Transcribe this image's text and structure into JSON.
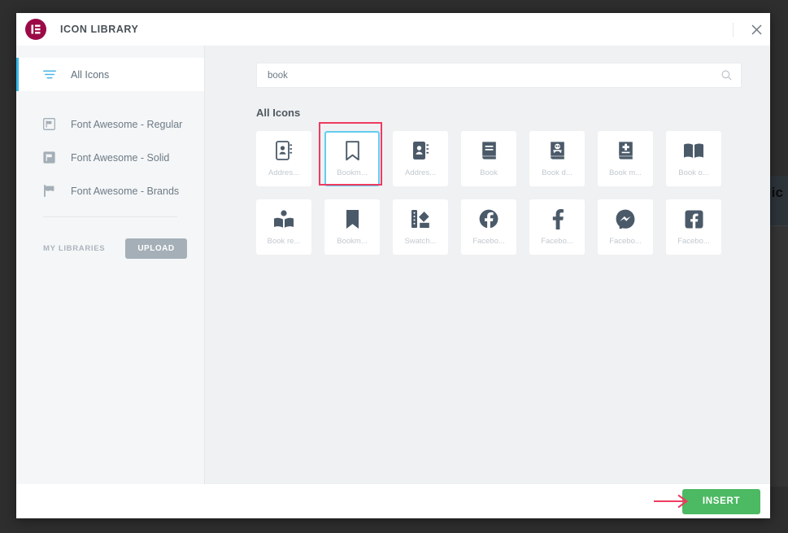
{
  "background": {
    "panel_text": "clic"
  },
  "modal": {
    "title": "ICON LIBRARY",
    "logo_icon": "elementor-logo-icon",
    "close_icon": "close-icon",
    "close_label": "Close"
  },
  "sidebar": {
    "items": [
      {
        "label": "All Icons",
        "icon": "filter-lines-icon",
        "active": true
      },
      {
        "label": "Font Awesome - Regular",
        "icon": "flag-regular-icon",
        "active": false
      },
      {
        "label": "Font Awesome - Solid",
        "icon": "flag-solid-icon",
        "active": false
      },
      {
        "label": "Font Awesome - Brands",
        "icon": "flag-brands-icon",
        "active": false
      }
    ],
    "libraries_label": "MY LIBRARIES",
    "upload_label": "UPLOAD"
  },
  "search": {
    "value": "book",
    "placeholder": "Search",
    "icon": "search-icon"
  },
  "content": {
    "section_title": "All Icons",
    "icons": [
      {
        "caption": "Addres...",
        "glyph": "address-book-regular-icon",
        "selected": false
      },
      {
        "caption": "Bookm...",
        "glyph": "bookmark-regular-icon",
        "selected": true
      },
      {
        "caption": "Addres...",
        "glyph": "address-book-solid-icon",
        "selected": false
      },
      {
        "caption": "Book",
        "glyph": "book-icon",
        "selected": false
      },
      {
        "caption": "Book d...",
        "glyph": "book-dead-icon",
        "selected": false
      },
      {
        "caption": "Book m...",
        "glyph": "book-medical-icon",
        "selected": false
      },
      {
        "caption": "Book o...",
        "glyph": "book-open-icon",
        "selected": false
      },
      {
        "caption": "Book re...",
        "glyph": "book-reader-icon",
        "selected": false
      },
      {
        "caption": "Bookm...",
        "glyph": "bookmark-solid-icon",
        "selected": false
      },
      {
        "caption": "Swatch...",
        "glyph": "swatchbook-icon",
        "selected": false
      },
      {
        "caption": "Facebo...",
        "glyph": "facebook-circle-icon",
        "selected": false
      },
      {
        "caption": "Facebo...",
        "glyph": "facebook-f-icon",
        "selected": false
      },
      {
        "caption": "Facebo...",
        "glyph": "facebook-messenger-icon",
        "selected": false
      },
      {
        "caption": "Facebo...",
        "glyph": "facebook-square-icon",
        "selected": false
      }
    ]
  },
  "footer": {
    "insert_label": "INSERT",
    "annotation_arrow": "red-arrow-annotation"
  },
  "colors": {
    "brand": "#9b0a46",
    "accent": "#39b9ea",
    "selection_border": "#63cdf0",
    "annotation": "#ef3b60",
    "insert": "#4cb963",
    "upload": "#a4afb7"
  }
}
